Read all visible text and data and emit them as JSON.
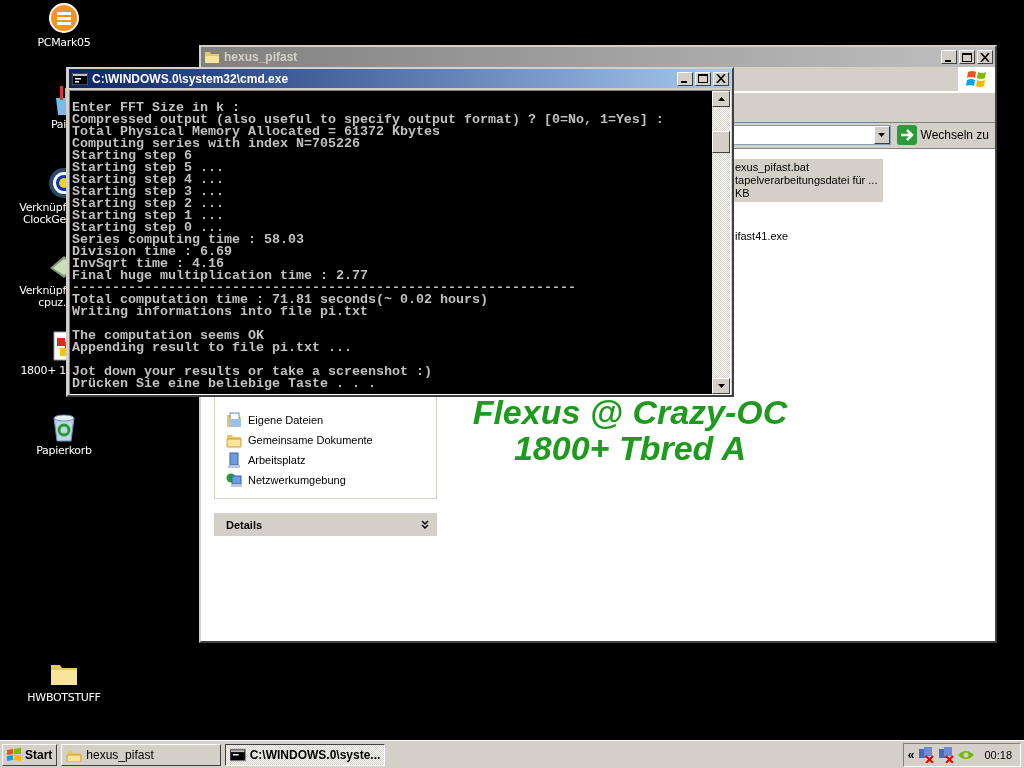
{
  "desktop_icons": [
    {
      "label_lines": [
        "PCMark05"
      ]
    },
    {
      "label_lines": [
        "Pai"
      ]
    },
    {
      "label_lines": [
        "Verknüpf",
        "ClockGe"
      ]
    },
    {
      "label_lines": [
        "Verknüpf",
        "cpuz."
      ]
    },
    {
      "label_lines": [
        "1800+ 1"
      ]
    },
    {
      "label_lines": [
        "Papierkorb"
      ]
    },
    {
      "label_lines": [
        "HWBOTSTUFF"
      ]
    }
  ],
  "explorer_window": {
    "title": "hexus_pifast",
    "active": false,
    "go_button": "Wechseln zu",
    "sidebar_items": [
      "Eigene Dateien",
      "Gemeinsame Dokumente",
      "Arbeitsplatz",
      "Netzwerkumgebung"
    ],
    "details_header": "Details",
    "files": [
      {
        "lines": [
          "exus_pifast.bat",
          "tapelverarbeitungsdatei für ...",
          "KB"
        ],
        "selected": true
      },
      {
        "lines": [
          "ifast41.exe"
        ],
        "selected": false
      }
    ]
  },
  "overlay_text": [
    "Flexus @ Crazy-OC",
    "1800+ Tbred A"
  ],
  "console_window": {
    "title": "C:\\WINDOWS.0\\system32\\cmd.exe",
    "active": true,
    "blocks": [
      [
        "Enter FFT Size in k :",
        "Compressed output (also useful to specify output format) ? [0=No, 1=Yes] :",
        "Total Physical Memory Allocated = 61372 Kbytes",
        "Computing series with index N=705226",
        "Starting step 6",
        "Starting step 5 ...",
        "Starting step 4 ...",
        "Starting step 3 ...",
        "Starting step 2 ...",
        "Starting step 1 ...",
        "Starting step 0 ...",
        "Series computing time : 58.03",
        "Division time : 6.69",
        "InvSqrt time : 4.16",
        "Final huge multiplication time : 2.77",
        "---------------------------------------------------------------",
        "Total computation time : 71.81 seconds(~ 0.02 hours)",
        "Writing informations into file pi.txt"
      ],
      [
        "The computation seems OK",
        "Appending result to file pi.txt ..."
      ],
      [
        "Jot down your results or take a screenshot :)",
        "Drücken Sie eine beliebige Taste . . ."
      ]
    ]
  },
  "taskbar": {
    "start": "Start",
    "tasks": [
      {
        "label": "hexus_pifast",
        "selected": false
      },
      {
        "label": "C:\\WINDOWS.0\\syste...",
        "selected": true
      }
    ],
    "tray_toggle": "«",
    "clock": "00:18"
  }
}
